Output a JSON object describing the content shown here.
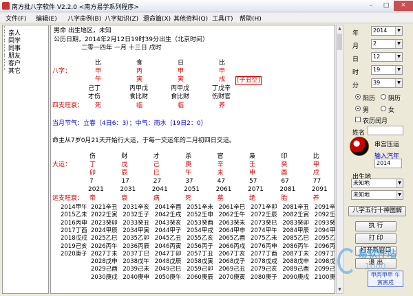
{
  "window": {
    "title": "南方批八字软件 V2.2.0  <南方易学系列程序>",
    "minimize": "–",
    "maximize": "□",
    "close": "✕"
  },
  "menu": [
    "文件(F)",
    "编辑(E)",
    "八字命例(B)",
    "八字知识(Z)",
    "遗命篇(X)",
    "其他资料(Q)",
    "工具(T)",
    "帮助(H)"
  ],
  "sidebar": {
    "items": [
      "亲人",
      "同学",
      "同事",
      "朋友",
      "客户",
      "其它"
    ]
  },
  "content": {
    "line1": "男命      出生地区，未知",
    "line2": "公历日期，2014年2月12日19时39分出生（北京时间）",
    "line3": "二零一四年        一月            十三日            戌时",
    "shishen_top": [
      "比",
      "食",
      "日",
      "比"
    ],
    "bazi_label": "八字：",
    "stems": [
      "甲",
      "丙",
      "甲",
      "甲"
    ],
    "branches": [
      "午",
      "寅",
      "寅",
      "戌"
    ],
    "kongwang": "[子丑空]",
    "hidden_stems": [
      "己丁",
      "丙甲戊",
      "丙甲戊",
      "丁戊辛"
    ],
    "hidden_shishen": [
      "才伤",
      "食比财",
      "食比财",
      "伤财官"
    ],
    "wangshuai_label": "四支旺衰：",
    "wangshuai": [
      "死",
      "临",
      "临",
      "养"
    ],
    "jieqi": "当月节气：立春（4日6：3）；中气：雨水（19日2：0）",
    "dayun_start": "命主从7岁0月21天开始行大运，于每一交运年的二月初四日交运。",
    "dayun_shishen": [
      "伤",
      "财",
      "才",
      "杀",
      "官",
      "枭",
      "印",
      "比"
    ],
    "dayun_label": "大运：",
    "dayun_stems": [
      "丁",
      "戊",
      "己",
      "庚",
      "辛",
      "壬",
      "癸",
      "甲"
    ],
    "dayun_branches": [
      "卯",
      "辰",
      "巳",
      "午",
      "未",
      "申",
      "酉",
      "戌"
    ],
    "dayun_ages": [
      "7",
      "17",
      "27",
      "37",
      "47",
      "57",
      "67",
      "77"
    ],
    "dayun_years": [
      "2021",
      "2031",
      "2041",
      "2051",
      "2061",
      "2071",
      "2081",
      "2091"
    ],
    "yun_wangshuai_label": "运支旺衰：",
    "yun_wangshuai": [
      "帝",
      "衰",
      "病",
      "死",
      "墓",
      "绝",
      "胎",
      "养"
    ],
    "liunian_col0": [
      "2014甲午",
      "2015乙未",
      "2016丙申",
      "2017丁酉",
      "2018戊戌",
      "2019己亥",
      "2020庚子"
    ],
    "liunian": [
      [
        "2021辛丑",
        "2022壬寅",
        "2023癸卯",
        "2024甲辰",
        "2025乙巳",
        "2026丙午",
        "2027丁未",
        "2028戊申",
        "2029己酉",
        "2030庚戌"
      ],
      [
        "2031辛亥",
        "2032壬子",
        "2033癸丑",
        "2034甲寅",
        "2035乙卯",
        "2036丙辰",
        "2037丁巳",
        "2038戊午",
        "2039己未",
        "2040庚申"
      ],
      [
        "2041辛酉",
        "2042壬戌",
        "2043癸亥",
        "2044甲子",
        "2045乙丑",
        "2046丙寅",
        "2047丁卯",
        "2048戊辰",
        "2049己巳",
        "2050庚午"
      ],
      [
        "2051辛未",
        "2052壬申",
        "2053癸酉",
        "2054甲戌",
        "2055乙亥",
        "2056丙子",
        "2057丁丑",
        "2058戊寅",
        "2059己卯",
        "2060庚辰"
      ],
      [
        "2061辛巳",
        "2062壬午",
        "2063癸未",
        "2064甲申",
        "2065乙酉",
        "2066丙戌",
        "2067丁亥",
        "2068戊子",
        "2069己丑",
        "2070庚寅"
      ],
      [
        "2071辛卯",
        "2072壬辰",
        "2073癸巳",
        "2074甲午",
        "2075乙未",
        "2076丙申",
        "2077丁酉",
        "2078戊戌",
        "2079己亥",
        "2080庚子"
      ],
      [
        "2081辛丑",
        "2082壬寅",
        "2083癸卯",
        "2084甲辰",
        "2085乙巳",
        "2086丙午",
        "2087丁未",
        "2088戊申",
        "2089己酉",
        "2090庚戌"
      ],
      [
        "2091辛亥",
        "2092壬子",
        "2093癸丑",
        "2094甲寅",
        "2095乙卯",
        "2096丙辰",
        "2097丁巳",
        "2098戊午",
        "2099己未",
        "2100庚申"
      ]
    ]
  },
  "panel": {
    "year_label": "年",
    "year": "2014",
    "month_label": "月",
    "month": "2",
    "day_label": "日",
    "day": "12",
    "hour_label": "时",
    "hour": "19",
    "minute_label": "分",
    "minute": "39",
    "calendar_solar": "阳历",
    "calendar_lunar": "阴历",
    "gender_male": "男",
    "gender_female": "女",
    "leap_month": "农历闰月",
    "name_label": "姓名",
    "name_value": "",
    "chuanyan_label": "串宫压运",
    "input_year_label": "输入汽年",
    "input_year": "2014",
    "birthplace_label": "出生地",
    "birthplace1": "未知地",
    "birthplace2": "未知地",
    "wuxing_button": "八字五行十神图解",
    "run_button": "执 行",
    "print_button": "打 印",
    "new_window_button": "打开新窗口",
    "exit_button": "退 出",
    "seal_text": "甲丙甲甲 午寅寅戌"
  },
  "watermark": {
    "text": "易软件站",
    "sub": "1000"
  }
}
